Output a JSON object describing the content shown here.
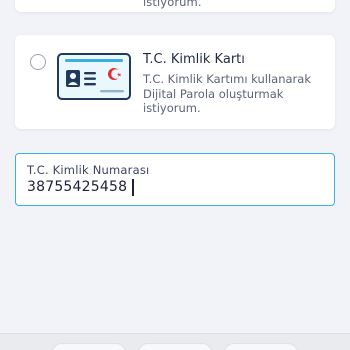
{
  "previous_option": {
    "description_tail": "istiyorum."
  },
  "option": {
    "title": "T.C. Kimlik Kartı",
    "description": "T.C. Kimlik Kartımı kullanarak Dijital Parola oluşturmak istiyorum.",
    "icon": "id-card-icon",
    "selected": false
  },
  "id_input": {
    "label": "T.C. Kimlik Numarası",
    "value": "38755425458"
  },
  "colors": {
    "accent": "#3ab0e0",
    "icon_navy": "#1f3a5c",
    "flag_red": "#e0303a",
    "background": "#f1f3f8"
  }
}
